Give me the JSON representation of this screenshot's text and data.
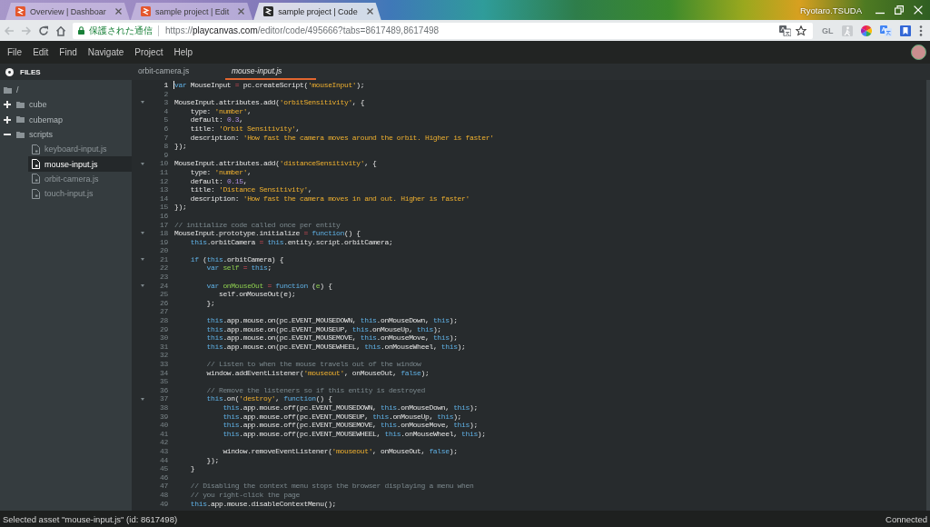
{
  "browser": {
    "tabs": [
      {
        "title": "Overview | Dashboar",
        "color": "#e4572e",
        "selected": false
      },
      {
        "title": "sample project | Edit",
        "color": "#e4572e",
        "selected": false
      },
      {
        "title": "sample project | Code",
        "color": "#2b2b2b",
        "selected": true
      }
    ],
    "profile_name": "Ryotaro.TSUDA",
    "nav_buttons": [
      {
        "kind": "back",
        "disabled": true
      },
      {
        "kind": "forward",
        "disabled": true
      },
      {
        "kind": "reload",
        "disabled": false
      },
      {
        "kind": "home",
        "disabled": false
      }
    ],
    "address_bar": {
      "security_label": "保護された通信",
      "url": "https://**playcanvas.com**/editor/code/495666?tabs=8617489,8617498"
    },
    "extension_label": "GL"
  },
  "menu": [
    "File",
    "Edit",
    "Find",
    "Navigate",
    "Project",
    "Help"
  ],
  "sidebar": {
    "title": "FILES",
    "tree": [
      {
        "label": "/",
        "kind": "folder",
        "selected": false,
        "children": [
          {
            "label": "cube",
            "kind": "folder",
            "expanded": false,
            "selected": false
          },
          {
            "label": "cubemap",
            "kind": "folder",
            "expanded": false,
            "selected": false
          },
          {
            "label": "scripts",
            "kind": "folder",
            "expanded": true,
            "selected": false,
            "children": [
              {
                "label": "keyboard-input.js",
                "kind": "file",
                "selected": false
              },
              {
                "label": "mouse-input.js",
                "kind": "file",
                "selected": true
              },
              {
                "label": "orbit-camera.js",
                "kind": "file",
                "selected": false
              },
              {
                "label": "touch-input.js",
                "kind": "file",
                "selected": false
              }
            ]
          }
        ]
      }
    ]
  },
  "editor_tabs": [
    {
      "label": "orbit-camera.js",
      "selected": false
    },
    {
      "label": "mouse-input.js",
      "selected": true
    }
  ],
  "code_lines": [
    {
      "number": "1",
      "active": true,
      "foldable": false,
      "tokens": [
        {
          "text": "var",
          "kind": "keyword"
        },
        {
          "text": " MouseInput ",
          "kind": "plain"
        },
        {
          "text": "=",
          "kind": "operator"
        },
        {
          "text": " pc.createScript(",
          "kind": "plain"
        },
        {
          "text": "'mouseInput'",
          "kind": "string"
        },
        {
          "text": ");",
          "kind": "plain"
        }
      ]
    },
    {
      "number": "2",
      "active": false,
      "foldable": false
    },
    {
      "number": "3",
      "active": false,
      "foldable": true,
      "tokens": [
        {
          "text": "MouseInput.attributes.add(",
          "kind": "plain"
        },
        {
          "text": "'orbitSensitivity'",
          "kind": "string"
        },
        {
          "text": ", {",
          "kind": "plain"
        }
      ]
    },
    {
      "number": "4",
      "active": false,
      "foldable": false,
      "tokens": [
        {
          "text": "    type: ",
          "kind": "plain"
        },
        {
          "text": "'number'",
          "kind": "string"
        },
        {
          "text": ",",
          "kind": "plain"
        }
      ]
    },
    {
      "number": "5",
      "active": false,
      "foldable": false,
      "tokens": [
        {
          "text": "    default: ",
          "kind": "plain"
        },
        {
          "text": "0.3",
          "kind": "number"
        },
        {
          "text": ",",
          "kind": "plain"
        }
      ]
    },
    {
      "number": "6",
      "active": false,
      "foldable": false,
      "tokens": [
        {
          "text": "    title: ",
          "kind": "plain"
        },
        {
          "text": "'Orbit Sensitivity'",
          "kind": "string"
        },
        {
          "text": ",",
          "kind": "plain"
        }
      ]
    },
    {
      "number": "7",
      "active": false,
      "foldable": false,
      "tokens": [
        {
          "text": "    description: ",
          "kind": "plain"
        },
        {
          "text": "'How fast the camera moves around the orbit. Higher is faster'",
          "kind": "string"
        }
      ]
    },
    {
      "number": "8",
      "active": false,
      "foldable": false,
      "tokens": [
        {
          "text": "});",
          "kind": "plain"
        }
      ]
    },
    {
      "number": "9",
      "active": false,
      "foldable": false
    },
    {
      "number": "10",
      "active": false,
      "foldable": true,
      "tokens": [
        {
          "text": "MouseInput.attributes.add(",
          "kind": "plain"
        },
        {
          "text": "'distanceSensitivity'",
          "kind": "string"
        },
        {
          "text": ", {",
          "kind": "plain"
        }
      ]
    },
    {
      "number": "11",
      "active": false,
      "foldable": false,
      "tokens": [
        {
          "text": "    type: ",
          "kind": "plain"
        },
        {
          "text": "'number'",
          "kind": "string"
        },
        {
          "text": ",",
          "kind": "plain"
        }
      ]
    },
    {
      "number": "12",
      "active": false,
      "foldable": false,
      "tokens": [
        {
          "text": "    default: ",
          "kind": "plain"
        },
        {
          "text": "0.15",
          "kind": "number"
        },
        {
          "text": ",",
          "kind": "plain"
        }
      ]
    },
    {
      "number": "13",
      "active": false,
      "foldable": false,
      "tokens": [
        {
          "text": "    title: ",
          "kind": "plain"
        },
        {
          "text": "'Distance Sensitivity'",
          "kind": "string"
        },
        {
          "text": ",",
          "kind": "plain"
        }
      ]
    },
    {
      "number": "14",
      "active": false,
      "foldable": false,
      "tokens": [
        {
          "text": "    description: ",
          "kind": "plain"
        },
        {
          "text": "'How fast the camera moves in and out. Higher is faster'",
          "kind": "string"
        }
      ]
    },
    {
      "number": "15",
      "active": false,
      "foldable": false,
      "tokens": [
        {
          "text": "});",
          "kind": "plain"
        }
      ]
    },
    {
      "number": "16",
      "active": false,
      "foldable": false
    },
    {
      "number": "17",
      "active": false,
      "foldable": false,
      "tokens": [
        {
          "text": "// initialize code called once per entity",
          "kind": "comment"
        }
      ]
    },
    {
      "number": "18",
      "active": false,
      "foldable": true,
      "tokens": [
        {
          "text": "MouseInput.prototype.initialize ",
          "kind": "plain"
        },
        {
          "text": "= ",
          "kind": "operator"
        },
        {
          "text": "function",
          "kind": "keyword"
        },
        {
          "text": "() {",
          "kind": "plain"
        }
      ]
    },
    {
      "number": "19",
      "active": false,
      "foldable": false,
      "tokens": [
        {
          "text": "    this",
          "kind": "keyword"
        },
        {
          "text": ".orbitCamera ",
          "kind": "plain"
        },
        {
          "text": "= ",
          "kind": "operator"
        },
        {
          "text": "this",
          "kind": "keyword"
        },
        {
          "text": ".entity.script.orbitCamera;",
          "kind": "plain"
        }
      ]
    },
    {
      "number": "20",
      "active": false,
      "foldable": false
    },
    {
      "number": "21",
      "active": false,
      "foldable": true,
      "tokens": [
        {
          "text": "    if",
          "kind": "keyword"
        },
        {
          "text": " (",
          "kind": "plain"
        },
        {
          "text": "this",
          "kind": "keyword"
        },
        {
          "text": ".orbitCamera) {",
          "kind": "plain"
        }
      ]
    },
    {
      "number": "22",
      "active": false,
      "foldable": false,
      "tokens": [
        {
          "text": "        var ",
          "kind": "keyword"
        },
        {
          "text": "self ",
          "kind": "variable"
        },
        {
          "text": "= ",
          "kind": "operator"
        },
        {
          "text": "this",
          "kind": "keyword"
        },
        {
          "text": ";",
          "kind": "plain"
        }
      ]
    },
    {
      "number": "23",
      "active": false,
      "foldable": false
    },
    {
      "number": "24",
      "active": false,
      "foldable": true,
      "tokens": [
        {
          "text": "        var ",
          "kind": "keyword"
        },
        {
          "text": "onMouseOut ",
          "kind": "variable"
        },
        {
          "text": "= ",
          "kind": "operator"
        },
        {
          "text": "function",
          "kind": "keyword"
        },
        {
          "text": " (",
          "kind": "plain"
        },
        {
          "text": "e",
          "kind": "variable"
        },
        {
          "text": ") {",
          "kind": "plain"
        }
      ]
    },
    {
      "number": "25",
      "active": false,
      "foldable": false,
      "tokens": [
        {
          "text": "           self.onMouseOut(e);",
          "kind": "plain"
        }
      ]
    },
    {
      "number": "26",
      "active": false,
      "foldable": false,
      "tokens": [
        {
          "text": "        };",
          "kind": "plain"
        }
      ]
    },
    {
      "number": "27",
      "active": false,
      "foldable": false
    },
    {
      "number": "28",
      "active": false,
      "foldable": false,
      "tokens": [
        {
          "text": "        this",
          "kind": "keyword"
        },
        {
          "text": ".app.mouse.on(pc.EVENT_MOUSEDOWN, ",
          "kind": "plain"
        },
        {
          "text": "this",
          "kind": "keyword"
        },
        {
          "text": ".onMouseDown, ",
          "kind": "plain"
        },
        {
          "text": "this",
          "kind": "keyword"
        },
        {
          "text": ");",
          "kind": "plain"
        }
      ]
    },
    {
      "number": "29",
      "active": false,
      "foldable": false,
      "tokens": [
        {
          "text": "        this",
          "kind": "keyword"
        },
        {
          "text": ".app.mouse.on(pc.EVENT_MOUSEUP, ",
          "kind": "plain"
        },
        {
          "text": "this",
          "kind": "keyword"
        },
        {
          "text": ".onMouseUp, ",
          "kind": "plain"
        },
        {
          "text": "this",
          "kind": "keyword"
        },
        {
          "text": ");",
          "kind": "plain"
        }
      ]
    },
    {
      "number": "30",
      "active": false,
      "foldable": false,
      "tokens": [
        {
          "text": "        this",
          "kind": "keyword"
        },
        {
          "text": ".app.mouse.on(pc.EVENT_MOUSEMOVE, ",
          "kind": "plain"
        },
        {
          "text": "this",
          "kind": "keyword"
        },
        {
          "text": ".onMouseMove, ",
          "kind": "plain"
        },
        {
          "text": "this",
          "kind": "keyword"
        },
        {
          "text": ");",
          "kind": "plain"
        }
      ]
    },
    {
      "number": "31",
      "active": false,
      "foldable": false,
      "tokens": [
        {
          "text": "        this",
          "kind": "keyword"
        },
        {
          "text": ".app.mouse.on(pc.EVENT_MOUSEWHEEL, ",
          "kind": "plain"
        },
        {
          "text": "this",
          "kind": "keyword"
        },
        {
          "text": ".onMouseWheel, ",
          "kind": "plain"
        },
        {
          "text": "this",
          "kind": "keyword"
        },
        {
          "text": ");",
          "kind": "plain"
        }
      ]
    },
    {
      "number": "32",
      "active": false,
      "foldable": false
    },
    {
      "number": "33",
      "active": false,
      "foldable": false,
      "tokens": [
        {
          "text": "        // Listen to when the mouse travels out of the window",
          "kind": "comment"
        }
      ]
    },
    {
      "number": "34",
      "active": false,
      "foldable": false,
      "tokens": [
        {
          "text": "        window.addEventListener(",
          "kind": "plain"
        },
        {
          "text": "'mouseout'",
          "kind": "string"
        },
        {
          "text": ", onMouseOut, ",
          "kind": "plain"
        },
        {
          "text": "false",
          "kind": "keyword"
        },
        {
          "text": ");",
          "kind": "plain"
        }
      ]
    },
    {
      "number": "35",
      "active": false,
      "foldable": false
    },
    {
      "number": "36",
      "active": false,
      "foldable": false,
      "tokens": [
        {
          "text": "        // Remove the listeners so if this entity is destroyed",
          "kind": "comment"
        }
      ]
    },
    {
      "number": "37",
      "active": false,
      "foldable": true,
      "tokens": [
        {
          "text": "        this",
          "kind": "keyword"
        },
        {
          "text": ".on(",
          "kind": "plain"
        },
        {
          "text": "'destroy'",
          "kind": "string"
        },
        {
          "text": ", ",
          "kind": "plain"
        },
        {
          "text": "function",
          "kind": "keyword"
        },
        {
          "text": "() {",
          "kind": "plain"
        }
      ]
    },
    {
      "number": "38",
      "active": false,
      "foldable": false,
      "tokens": [
        {
          "text": "            this",
          "kind": "keyword"
        },
        {
          "text": ".app.mouse.off(pc.EVENT_MOUSEDOWN, ",
          "kind": "plain"
        },
        {
          "text": "this",
          "kind": "keyword"
        },
        {
          "text": ".onMouseDown, ",
          "kind": "plain"
        },
        {
          "text": "this",
          "kind": "keyword"
        },
        {
          "text": ");",
          "kind": "plain"
        }
      ]
    },
    {
      "number": "39",
      "active": false,
      "foldable": false,
      "tokens": [
        {
          "text": "            this",
          "kind": "keyword"
        },
        {
          "text": ".app.mouse.off(pc.EVENT_MOUSEUP, ",
          "kind": "plain"
        },
        {
          "text": "this",
          "kind": "keyword"
        },
        {
          "text": ".onMouseUp, ",
          "kind": "plain"
        },
        {
          "text": "this",
          "kind": "keyword"
        },
        {
          "text": ");",
          "kind": "plain"
        }
      ]
    },
    {
      "number": "40",
      "active": false,
      "foldable": false,
      "tokens": [
        {
          "text": "            this",
          "kind": "keyword"
        },
        {
          "text": ".app.mouse.off(pc.EVENT_MOUSEMOVE, ",
          "kind": "plain"
        },
        {
          "text": "this",
          "kind": "keyword"
        },
        {
          "text": ".onMouseMove, ",
          "kind": "plain"
        },
        {
          "text": "this",
          "kind": "keyword"
        },
        {
          "text": ");",
          "kind": "plain"
        }
      ]
    },
    {
      "number": "41",
      "active": false,
      "foldable": false,
      "tokens": [
        {
          "text": "            this",
          "kind": "keyword"
        },
        {
          "text": ".app.mouse.off(pc.EVENT_MOUSEWHEEL, ",
          "kind": "plain"
        },
        {
          "text": "this",
          "kind": "keyword"
        },
        {
          "text": ".onMouseWheel, ",
          "kind": "plain"
        },
        {
          "text": "this",
          "kind": "keyword"
        },
        {
          "text": ");",
          "kind": "plain"
        }
      ]
    },
    {
      "number": "42",
      "active": false,
      "foldable": false
    },
    {
      "number": "43",
      "active": false,
      "foldable": false,
      "tokens": [
        {
          "text": "            window.removeEventListener(",
          "kind": "plain"
        },
        {
          "text": "'mouseout'",
          "kind": "string"
        },
        {
          "text": ", onMouseOut, ",
          "kind": "plain"
        },
        {
          "text": "false",
          "kind": "keyword"
        },
        {
          "text": ");",
          "kind": "plain"
        }
      ]
    },
    {
      "number": "44",
      "active": false,
      "foldable": false,
      "tokens": [
        {
          "text": "        });",
          "kind": "plain"
        }
      ]
    },
    {
      "number": "45",
      "active": false,
      "foldable": false,
      "tokens": [
        {
          "text": "    }",
          "kind": "plain"
        }
      ]
    },
    {
      "number": "46",
      "active": false,
      "foldable": false
    },
    {
      "number": "47",
      "active": false,
      "foldable": false,
      "tokens": [
        {
          "text": "    // Disabling the context menu stops the browser displaying a menu when",
          "kind": "comment"
        }
      ]
    },
    {
      "number": "48",
      "active": false,
      "foldable": false,
      "tokens": [
        {
          "text": "    // you right-click the page",
          "kind": "comment"
        }
      ]
    },
    {
      "number": "49",
      "active": false,
      "foldable": false,
      "tokens": [
        {
          "text": "    this",
          "kind": "keyword"
        },
        {
          "text": ".app.mouse.disableContextMenu();",
          "kind": "plain"
        }
      ]
    }
  ],
  "status_bar": {
    "message": "Selected asset \"mouse-input.js\" (id: 8617498)",
    "connection": "Connected"
  }
}
